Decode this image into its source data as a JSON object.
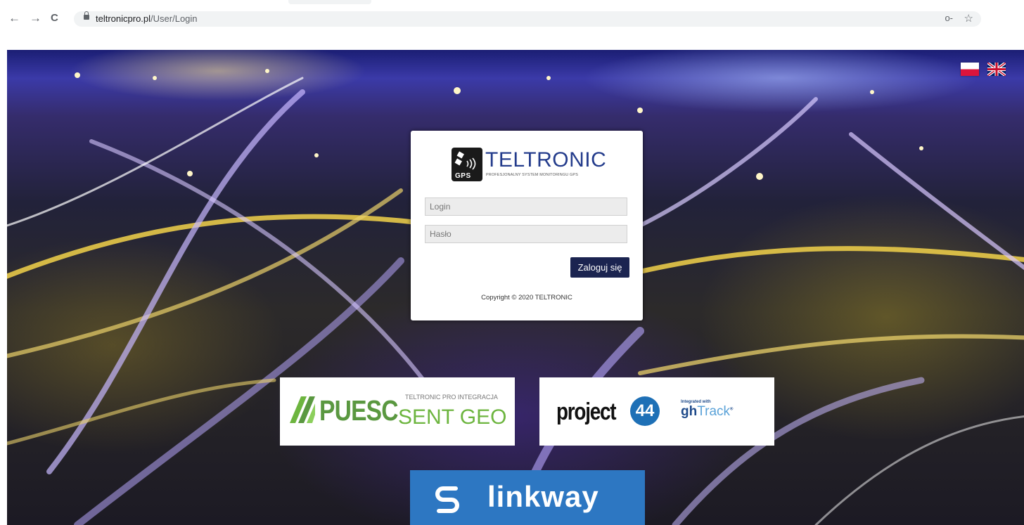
{
  "browser": {
    "back": "←",
    "forward": "→",
    "reload": "C",
    "url_host": "teltronicpro.pl",
    "url_path": "/User/Login",
    "key_icon": "key-icon",
    "star_icon": "star-icon"
  },
  "languages": [
    {
      "code": "pl",
      "icon": "flag-pl-icon"
    },
    {
      "code": "en",
      "icon": "flag-uk-icon"
    }
  ],
  "login": {
    "brand": "TELTRONIC",
    "brand_icon_text": "GPS",
    "tagline": "PROFESJONALNY SYSTEM MONITORINGU GPS",
    "login_placeholder": "Login",
    "password_placeholder": "Hasło",
    "submit_label": "Zaloguj się",
    "copyright": "Copyright © 2020 TELTRONIC"
  },
  "partners": {
    "puesc": {
      "name": "PUESC",
      "subtitle": "TELTRONIC PRO INTEGRACJA",
      "title": "SENT GEO"
    },
    "project44": {
      "name": "project",
      "badge": "44",
      "integrated": "Integrated with",
      "gh": "gh",
      "track": "Track",
      "reg": "®"
    },
    "linkway": {
      "name": "linkway"
    }
  },
  "colors": {
    "brand_blue": "#243c8c",
    "button": "#1b2450",
    "puesc_green": "#6db53f",
    "linkway_bg": "#2d77c2",
    "p44_blue": "#1e70b6"
  }
}
